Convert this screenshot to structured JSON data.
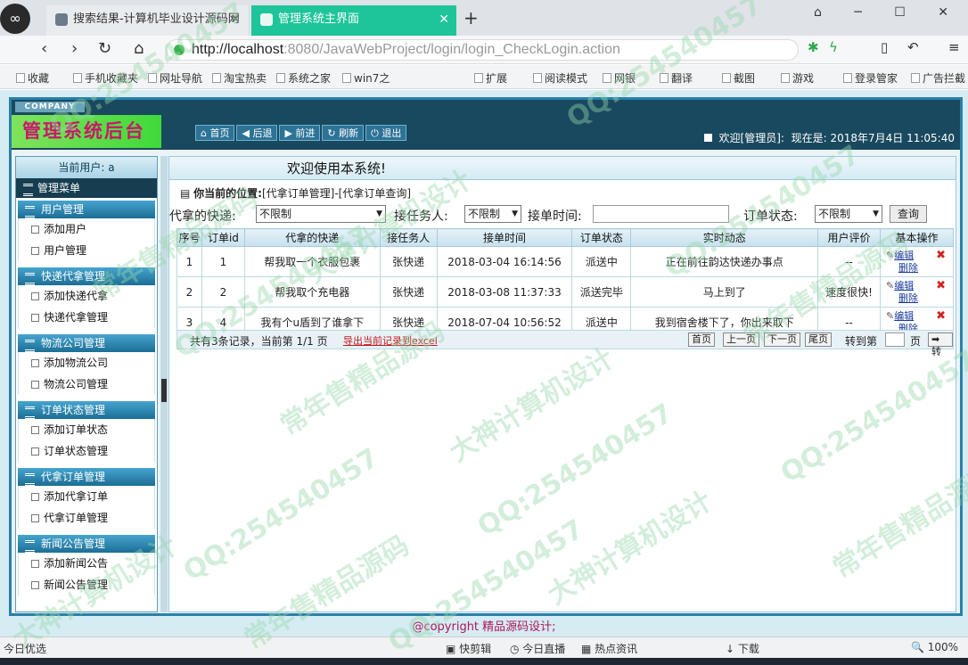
{
  "browser": {
    "tabs": [
      {
        "label": "搜索结果-计算机毕业设计源码网"
      },
      {
        "label": "管理系统主界面"
      }
    ],
    "close_glyph": "✕",
    "new_tab": "+",
    "url_host": "http://localhost",
    "url_path": ":8080/JavaWebProject/login/login_CheckLogin.action",
    "bookmarks": [
      "收藏",
      "手机收藏夹",
      "网址导航",
      "淘宝热卖",
      "系统之家",
      "win7之",
      "扩展",
      "阅读模式",
      "网银",
      "翻译",
      "截图",
      "游戏",
      "登录管家",
      "广告拦截"
    ]
  },
  "header": {
    "company": "COMPANY",
    "brand": "管理系统后台",
    "buttons": [
      "首页",
      "后退",
      "前进",
      "刷新",
      "退出"
    ],
    "welcome_user": "欢迎[管理员]:",
    "time_prefix": "现在是:",
    "time_value": "2018年7月4日 11:05:40"
  },
  "sidebar": {
    "current_user": "当前用户: a",
    "menu_title": "管理菜单",
    "groups": [
      {
        "title": "用户管理",
        "items": [
          "添加用户",
          "用户管理"
        ]
      },
      {
        "title": "快递代拿管理",
        "items": [
          "添加快递代拿",
          "快递代拿管理"
        ]
      },
      {
        "title": "物流公司管理",
        "items": [
          "添加物流公司",
          "物流公司管理"
        ]
      },
      {
        "title": "订单状态管理",
        "items": [
          "添加订单状态",
          "订单状态管理"
        ]
      },
      {
        "title": "代拿订单管理",
        "items": [
          "添加代拿订单",
          "代拿订单管理"
        ]
      },
      {
        "title": "新闻公告管理",
        "items": [
          "添加新闻公告",
          "新闻公告管理"
        ]
      }
    ]
  },
  "main": {
    "welcome": "欢迎使用本系统!",
    "location_label": "你当前的位置:",
    "location_path": "[代拿订单管理]-[代拿订单查询]",
    "search": {
      "label1": "代拿的快递:",
      "select1": "不限制",
      "label2": "接任务人:",
      "select2": "不限制",
      "label3": "接单时间:",
      "label4": "订单状态:",
      "select4": "不限制",
      "query": "查询"
    },
    "table": {
      "headers": [
        "序号",
        "订单id",
        "代拿的快递",
        "接任务人",
        "接单时间",
        "订单状态",
        "实时动态",
        "用户评价",
        "基本操作"
      ],
      "rows": [
        [
          "1",
          "1",
          "帮我取一个衣服包裹",
          "张快递",
          "2018-03-04 16:14:56",
          "派送中",
          "正在前往韵达快递办事点",
          "--"
        ],
        [
          "2",
          "2",
          "帮我取个充电器",
          "张快递",
          "2018-03-08 11:37:33",
          "派送完毕",
          "马上到了",
          "速度很快!"
        ],
        [
          "3",
          "4",
          "我有个u盾到了谁拿下",
          "张快递",
          "2018-07-04 10:56:52",
          "派送中",
          "我到宿舍楼下了，你出来取下",
          "--"
        ]
      ],
      "edit": "编辑",
      "delete": "删除"
    },
    "pager": {
      "summary": "共有3条记录，当前第 1/1 页",
      "export": "导出当前记录到excel",
      "first": "首页",
      "prev": "上一页",
      "next": "下一页",
      "last": "尾页",
      "goto": "转到第",
      "unit": "页",
      "go": "转"
    }
  },
  "footer": "@copyright 精品源码设计;",
  "statusbar": [
    "今日优选",
    "快剪辑",
    "今日直播",
    "热点资讯",
    "下载",
    "100%"
  ],
  "watermarks": [
    "QQ:254540457",
    "大神计算机设计",
    "常年售精品源码"
  ]
}
